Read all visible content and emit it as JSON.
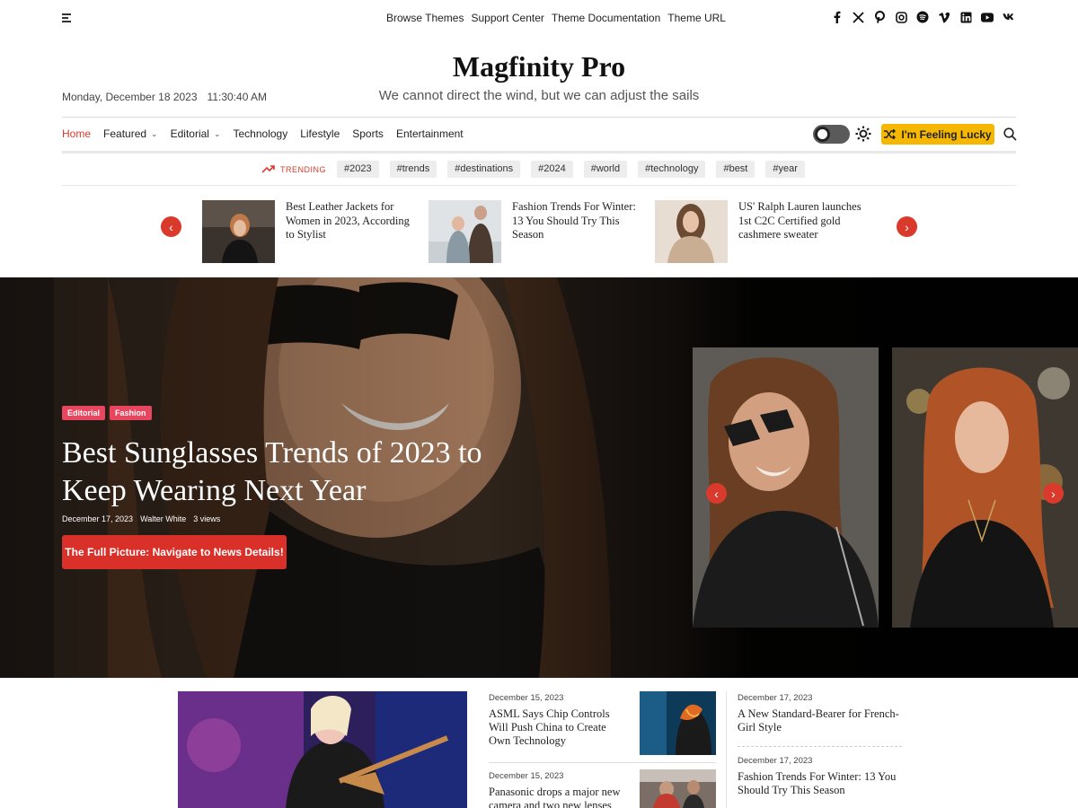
{
  "topbar": {
    "links": [
      "Browse Themes",
      "Support Center",
      "Theme Documentation",
      "Theme URL"
    ],
    "socials": [
      "facebook-icon",
      "x-twitter-icon",
      "pinterest-icon",
      "instagram-icon",
      "spotify-icon",
      "vimeo-icon",
      "linkedin-icon",
      "youtube-icon",
      "vk-icon"
    ]
  },
  "header": {
    "site_title": "Magfinity Pro",
    "tagline": "We cannot direct the wind, but we can adjust the sails",
    "date": "Monday, December 18 2023",
    "time": "11:30:40 AM"
  },
  "nav": {
    "items": [
      {
        "label": "Home",
        "active": true,
        "dropdown": false
      },
      {
        "label": "Featured",
        "dropdown": true
      },
      {
        "label": "Editorial",
        "dropdown": true
      },
      {
        "label": "Technology",
        "dropdown": false
      },
      {
        "label": "Lifestyle",
        "dropdown": false
      },
      {
        "label": "Sports",
        "dropdown": false
      },
      {
        "label": "Entertainment",
        "dropdown": false
      }
    ],
    "lucky_label": "I'm Feeling Lucky"
  },
  "trending": {
    "label": "TRENDING",
    "tags": [
      "#2023",
      "#trends",
      "#destinations",
      "#2024",
      "#world",
      "#technology",
      "#best",
      "#year"
    ]
  },
  "ticker": {
    "items": [
      {
        "title": "Best Leather Jackets for Women in 2023, According to Stylist"
      },
      {
        "title": "Fashion Trends For Winter: 13 You Should Try This Season"
      },
      {
        "title": "US' Ralph Lauren launches 1st C2C Certified gold cashmere sweater"
      }
    ]
  },
  "hero": {
    "badges": [
      "Editorial",
      "Fashion"
    ],
    "title": "Best Sunglasses Trends of 2023 to Keep Wearing Next Year",
    "date": "December 17, 2023",
    "author": "Walter White",
    "views": "3 views",
    "cta": "The Full Picture: Navigate to News Details!"
  },
  "posts": {
    "middle": [
      {
        "date": "December 15, 2023",
        "title": "ASML Says Chip Controls Will Push China to Create Own Technology"
      },
      {
        "date": "December 15, 2023",
        "title": "Panasonic drops a major new camera and two new lenses"
      }
    ],
    "right": [
      {
        "date": "December 17, 2023",
        "title": "A New Standard-Bearer for French-Girl Style"
      },
      {
        "date": "December 17, 2023",
        "title": "Fashion Trends For Winter: 13 You Should Try This Season"
      }
    ]
  },
  "colors": {
    "accent": "#d93a2b",
    "lucky": "#f5b700",
    "badge": "#e8455f"
  }
}
